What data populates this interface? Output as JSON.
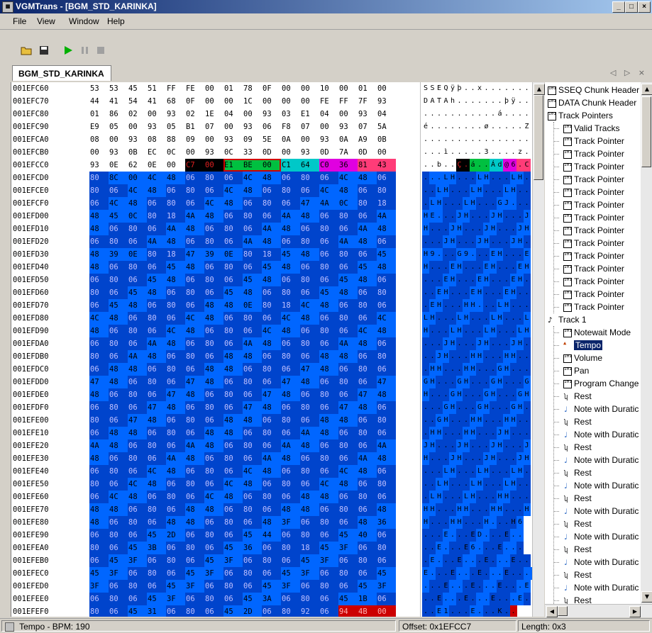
{
  "window": {
    "title": "VGMTrans - [BGM_STD_KARINKA]",
    "min": "_",
    "max": "□",
    "close": "×"
  },
  "menu": [
    "File",
    "View",
    "Window",
    "Help"
  ],
  "toolbar": [
    "open-icon",
    "save-icon",
    "play-icon",
    "pause-icon",
    "stop-icon"
  ],
  "tab": {
    "label": "BGM_STD_KARINKA",
    "nav": "◁ ▷ ×"
  },
  "colors": {
    "blue": "#0066ff",
    "blue_light": "#2a7cff",
    "dark": "#0044cc",
    "red": "#cc0000",
    "green": "#00c040",
    "cyan": "#00c8c8",
    "magenta": "#e000e0",
    "pink": "#ff3c78",
    "black": "#000000"
  },
  "hex": {
    "addresses": [
      "001EFC60",
      "001EFC70",
      "001EFC80",
      "001EFC90",
      "001EFCA0",
      "001EFCB0",
      "001EFCC0",
      "001EFCD0",
      "001EFCE0",
      "001EFCF0",
      "001EFD00",
      "001EFD10",
      "001EFD20",
      "001EFD30",
      "001EFD40",
      "001EFD50",
      "001EFD60",
      "001EFD70",
      "001EFD80",
      "001EFD90",
      "001EFDA0",
      "001EFDB0",
      "001EFDC0",
      "001EFDD0",
      "001EFDE0",
      "001EFDF0",
      "001EFE00",
      "001EFE10",
      "001EFE20",
      "001EFE30",
      "001EFE40",
      "001EFE50",
      "001EFE60",
      "001EFE70",
      "001EFE80",
      "001EFE90",
      "001EFEA0",
      "001EFEB0",
      "001EFEC0",
      "001EFED0",
      "001EFEE0",
      "001EFEF0"
    ],
    "rows": [
      "53 53 45 51 FF FE 00 01 78 0F 00 00 10 00 01 00",
      "44 41 54 41 68 0F 00 00 1C 00 00 00 FE FF 7F 93",
      "01 86 02 00 93 02 1E 04 00 93 03 E1 04 00 93 04",
      "E9 05 00 93 05 B1 07 00 93 06 F8 07 00 93 07 5A",
      "08 00 93 08 88 09 00 93 09 5E 0A 00 93 0A A9 0B",
      "00 93 0B EC 0C 00 93 0C 33 0D 00 93 0D 7A 0D 00",
      "93 0E 62 0E 00 C7 00 E1 BE 00 C1 64 C0 36 81 43",
      "80 8C 00 4C 48 06 80 06 4C 48 06 80 06 4C 48 06",
      "80 06 4C 48 06 80 06 4C 48 06 80 06 4C 48 06 80",
      "06 4C 48 06 80 06 4C 48 06 80 06 47 4A 0C 80 18",
      "48 45 0C 80 18 4A 48 06 80 06 4A 48 06 80 06 4A",
      "48 06 80 06 4A 48 06 80 06 4A 48 06 80 06 4A 48",
      "06 80 06 4A 48 06 80 06 4A 48 06 80 06 4A 48 06",
      "48 39 0E 80 18 47 39 0E 80 18 45 48 06 80 06 45",
      "48 06 80 06 45 48 06 80 06 45 48 06 80 06 45 48",
      "06 80 06 45 48 06 80 06 45 48 06 80 06 45 48 06",
      "80 06 45 48 06 80 06 45 48 06 80 06 45 48 06 80",
      "06 45 48 06 80 06 48 48 0E 80 18 4C 48 06 80 06",
      "4C 48 06 80 06 4C 48 06 80 06 4C 48 06 80 06 4C",
      "48 06 80 06 4C 48 06 80 06 4C 48 06 80 06 4C 48",
      "06 80 06 4A 48 06 80 06 4A 48 06 80 06 4A 48 06",
      "80 06 4A 48 06 80 06 48 48 06 80 06 48 48 06 80",
      "06 48 48 06 80 06 48 48 06 80 06 47 48 06 80 06",
      "47 48 06 80 06 47 48 06 80 06 47 48 06 80 06 47",
      "48 06 80 06 47 48 06 80 06 47 48 06 80 06 47 48",
      "06 80 06 47 48 06 80 06 47 48 06 80 06 47 48 06",
      "80 06 47 48 06 80 06 48 48 06 80 06 48 48 06 80",
      "06 48 48 06 80 06 48 48 06 80 06 4A 48 06 80 06",
      "4A 48 06 80 06 4A 48 06 80 06 4A 48 06 80 06 4A",
      "48 06 80 06 4A 48 06 80 06 4A 48 06 80 06 4A 48",
      "06 80 06 4C 48 06 80 06 4C 48 06 80 06 4C 48 06",
      "80 06 4C 48 06 80 06 4C 48 06 80 06 4C 48 06 80",
      "06 4C 48 06 80 06 4C 48 06 80 06 48 48 06 80 06",
      "48 48 06 80 06 48 48 06 80 06 48 48 06 80 06 48",
      "48 06 80 06 48 48 06 80 06 48 3F 06 80 06 48 36",
      "06 80 06 45 2D 06 80 06 45 44 06 80 06 45 40 06",
      "80 06 45 3B 06 80 06 45 36 06 80 18 45 3F 06 80",
      "06 45 3F 06 80 06 45 3F 06 80 06 45 3F 06 80 06",
      "45 3F 06 80 06 45 3F 06 80 06 45 3F 06 80 06 45",
      "3F 06 80 06 45 3F 06 80 06 45 3F 06 80 06 45 3F",
      "06 80 06 45 3F 06 80 06 45 3A 06 80 06 45 1B 06",
      "80 06 45 31 06 80 06 45 2D 06 80 92 06 94 4B 00"
    ],
    "ascii": [
      "SSEQÿþ..x.......",
      "DATAh.......þÿ..",
      "...........á....",
      "é........ø.....Z",
      "................",
      "...ì.....3....z.",
      "..b..Ç.á..Ád@6.C",
      "...LH...LH...LH.",
      "..LH...LH...LH..",
      ".LH...LH...GJ...",
      "HE...JH...JH...J",
      "H...JH...JH...JH",
      "...JH...JH...JH.",
      "H9...G9...EH...E",
      "H...EH...EH...EH",
      "...EH...EH...EH.",
      "..EH...EH...EH..",
      ".EH...HH...LH...",
      "LH...LH...LH...L",
      "H...LH...LH...LH",
      "...JH...JH...JH.",
      "..JH...HH...HH..",
      ".HH...HH...GH...",
      "GH...GH...GH...G",
      "H...GH...GH...GH",
      "...GH...GH...GH.",
      "..GH...HH...HH..",
      ".HH...HH...JH...",
      "JH...JH...JH...J",
      "H...JH...JH...JH",
      "...LH...LH...LH.",
      "..LH...LH...LH..",
      ".LH...LH...HH...",
      "HH...HH...HH...H",
      "H...HH...H...H6",
      "...E...ED...E..",
      "..E...E6...E...",
      ".E...E...E...E..",
      "E...E...E...E...E",
      "...E...E...E...E",
      "..E...E...E...E.",
      "..E1...E...K.."
    ]
  },
  "tree": [
    {
      "label": "SSEQ Chunk Header",
      "icon": "chunk-icon",
      "level": 0
    },
    {
      "label": "DATA Chunk Header",
      "icon": "chunk-icon",
      "level": 0
    },
    {
      "label": "Track Pointers",
      "icon": "chunk-icon",
      "level": 0
    },
    {
      "label": "Valid Tracks",
      "icon": "chunk-icon",
      "level": 1
    },
    {
      "label": "Track Pointer",
      "icon": "chunk-icon",
      "level": 1
    },
    {
      "label": "Track Pointer",
      "icon": "chunk-icon",
      "level": 1
    },
    {
      "label": "Track Pointer",
      "icon": "chunk-icon",
      "level": 1
    },
    {
      "label": "Track Pointer",
      "icon": "chunk-icon",
      "level": 1
    },
    {
      "label": "Track Pointer",
      "icon": "chunk-icon",
      "level": 1
    },
    {
      "label": "Track Pointer",
      "icon": "chunk-icon",
      "level": 1
    },
    {
      "label": "Track Pointer",
      "icon": "chunk-icon",
      "level": 1
    },
    {
      "label": "Track Pointer",
      "icon": "chunk-icon",
      "level": 1
    },
    {
      "label": "Track Pointer",
      "icon": "chunk-icon",
      "level": 1
    },
    {
      "label": "Track Pointer",
      "icon": "chunk-icon",
      "level": 1
    },
    {
      "label": "Track Pointer",
      "icon": "chunk-icon",
      "level": 1
    },
    {
      "label": "Track Pointer",
      "icon": "chunk-icon",
      "level": 1
    },
    {
      "label": "Track Pointer",
      "icon": "chunk-icon",
      "level": 1
    },
    {
      "label": "Track Pointer",
      "icon": "chunk-icon",
      "level": 1
    },
    {
      "label": "Track 1",
      "icon": "track-icon",
      "level": 0
    },
    {
      "label": "Notewait Mode",
      "icon": "chunk-icon",
      "level": 1
    },
    {
      "label": "Tempo",
      "icon": "metronome-icon",
      "level": 1,
      "selected": true
    },
    {
      "label": "Volume",
      "icon": "chunk-icon",
      "level": 1
    },
    {
      "label": "Pan",
      "icon": "chunk-icon",
      "level": 1
    },
    {
      "label": "Program Change",
      "icon": "chunk-icon",
      "level": 1
    },
    {
      "label": "Rest",
      "icon": "rest-icon",
      "level": 1
    },
    {
      "label": "Note with Duratic",
      "icon": "note-icon",
      "level": 1
    },
    {
      "label": "Rest",
      "icon": "rest-icon",
      "level": 1
    },
    {
      "label": "Note with Duratic",
      "icon": "note-icon",
      "level": 1
    },
    {
      "label": "Rest",
      "icon": "rest-icon",
      "level": 1
    },
    {
      "label": "Note with Duratic",
      "icon": "note-icon",
      "level": 1
    },
    {
      "label": "Rest",
      "icon": "rest-icon",
      "level": 1
    },
    {
      "label": "Note with Duratic",
      "icon": "note-icon",
      "level": 1
    },
    {
      "label": "Rest",
      "icon": "rest-icon",
      "level": 1
    },
    {
      "label": "Note with Duratic",
      "icon": "note-icon",
      "level": 1
    },
    {
      "label": "Rest",
      "icon": "rest-icon",
      "level": 1
    },
    {
      "label": "Note with Duratic",
      "icon": "note-icon",
      "level": 1
    },
    {
      "label": "Rest",
      "icon": "rest-icon",
      "level": 1
    },
    {
      "label": "Note with Duratic",
      "icon": "note-icon",
      "level": 1
    },
    {
      "label": "Rest",
      "icon": "rest-icon",
      "level": 1
    },
    {
      "label": "Note with Duratic",
      "icon": "note-icon",
      "level": 1
    },
    {
      "label": "Rest",
      "icon": "rest-icon",
      "level": 1
    }
  ],
  "status": {
    "left": "Tempo - BPM: 190",
    "offset": "Offset: 0x1EFCC7",
    "length": "Length: 0x3"
  }
}
